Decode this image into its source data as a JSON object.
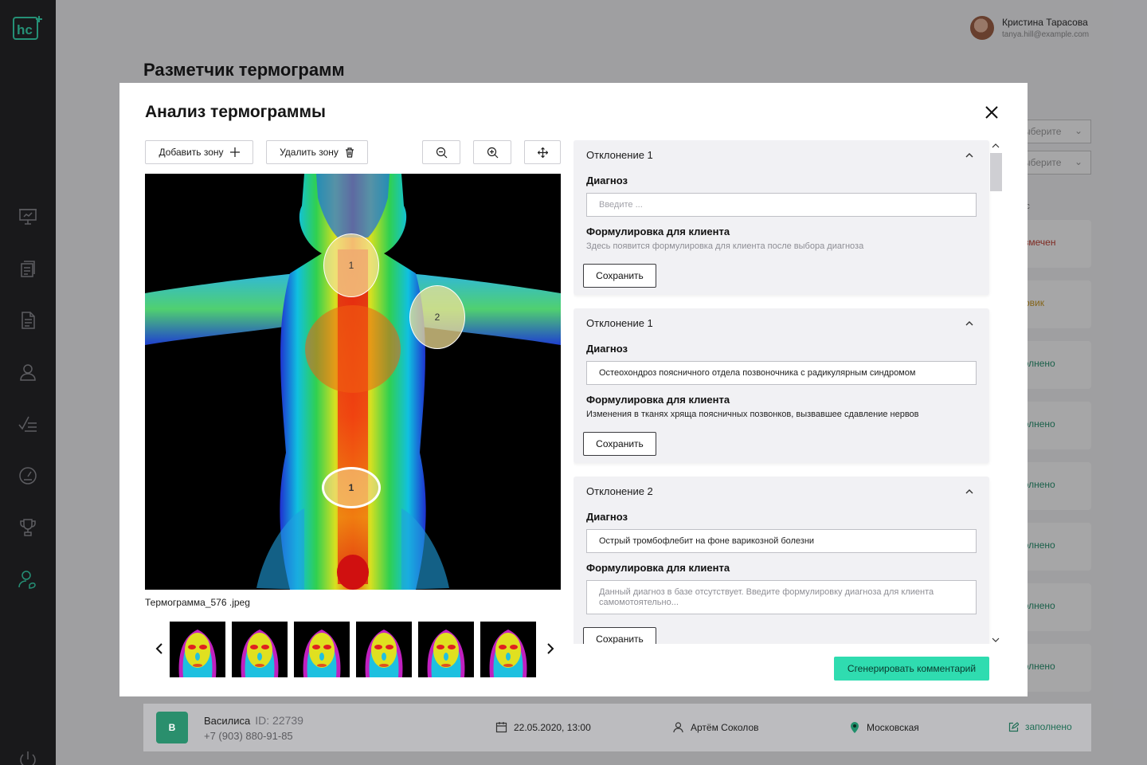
{
  "app": {
    "page_title": "Разметчик термограмм",
    "user": {
      "name": "Кристина Тарасова",
      "email": "tanya.hill@example.com"
    },
    "sidebar": [
      "presentation-icon",
      "documents-icon",
      "document-icon",
      "user-icon",
      "checklist-icon",
      "gauge-icon",
      "trophy-icon",
      "users-care-icon",
      "power-icon"
    ],
    "filters": [
      {
        "placeholder": "ыберите"
      },
      {
        "placeholder": "ыберите"
      }
    ],
    "status_header": "ус",
    "row_statuses": [
      {
        "text": "еразмечен",
        "color": "#c0392b"
      },
      {
        "text": "ерновик",
        "color": "#c9961b"
      },
      {
        "text": "заполнено",
        "color": "#1f8e6a"
      },
      {
        "text": "заполнено",
        "color": "#1f8e6a"
      },
      {
        "text": "заполнено",
        "color": "#1f8e6a"
      },
      {
        "text": "заполнено",
        "color": "#1f8e6a"
      },
      {
        "text": "заполнено",
        "color": "#1f8e6a"
      },
      {
        "text": "заполнено",
        "color": "#1f8e6a"
      }
    ],
    "patient_row": {
      "initial": "В",
      "name": "Василиса",
      "id": "ID: 22739",
      "phone": "+7 (903) 880-91-85",
      "datetime": "22.05.2020, 13:00",
      "doctor": "Артём Соколов",
      "region": "Московская",
      "status": "заполнено"
    }
  },
  "modal": {
    "title": "Анализ термограммы",
    "toolbar": {
      "add_zone": "Добавить зону",
      "delete_zone": "Удалить зону"
    },
    "image": {
      "file_name": "Термограмма_576 .jpeg",
      "zones": [
        "1",
        "2",
        "1"
      ]
    },
    "thumbnails_count": 6,
    "deviations": [
      {
        "title": "Отклонение 1",
        "diagnosis_label": "Диагноз",
        "diagnosis_value": "",
        "diagnosis_placeholder": "Введите ...",
        "client_label": "Формулировка для клиента",
        "client_text": "Здесь появится формулировка для клиента после выбора диагноза",
        "save": "Сохранить"
      },
      {
        "title": "Отклонение 1",
        "diagnosis_label": "Диагноз",
        "diagnosis_value": "Остеохондроз поясничного отдела позвоночника  с радикулярным синдромом",
        "client_label": "Формулировка для клиента",
        "client_text": "Изменения в тканях хряща поясничных позвонков, вызвавшее сдавление нервов",
        "save": "Сохранить"
      },
      {
        "title": "Отклонение 2",
        "diagnosis_label": "Диагноз",
        "diagnosis_value": "Острый тромбофлебит на фоне варикозной болезни",
        "client_label": "Формулировка для клиента",
        "client_placeholder": "Данный диагноз в базе отсутствует. Введите формулировку диагноза для клиента самомотоятельно...",
        "save": "Сохранить"
      }
    ],
    "generate_button": "Сгенерировать комментарий"
  }
}
